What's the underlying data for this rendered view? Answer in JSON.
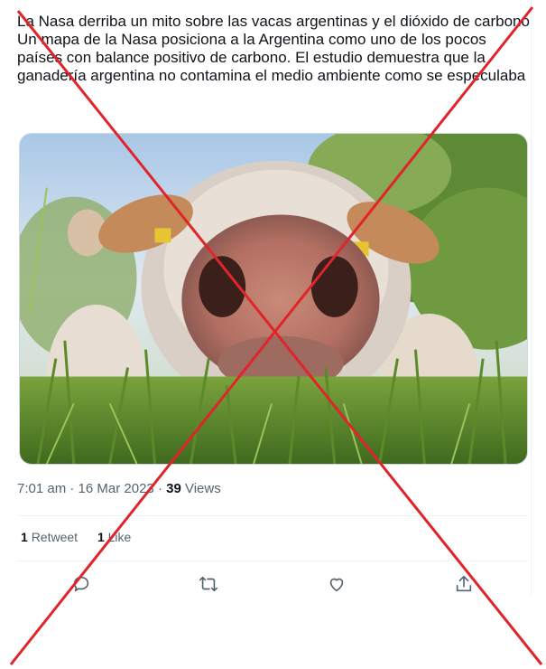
{
  "tweet": {
    "text_lines": [
      "La Nasa derriba un mito sobre las vacas argentinas y el dióxido de carbono",
      "Un mapa de la Nasa posiciona a la Argentina como uno de los pocos países con balance positivo de carbono. El estudio demuestra que la ganadería argentina no contamina el medio ambiente como se especulaba"
    ],
    "time": "7:01 am",
    "separator": "·",
    "date": "16 Mar 2023",
    "views_count": "39",
    "views_label": "Views",
    "retweets_count": "1",
    "retweets_label": "Retweet",
    "likes_count": "1",
    "likes_label": "Like"
  },
  "image": {
    "subject": "close-up cow nose in grass field"
  },
  "actions": [
    "reply-icon",
    "retweet-icon",
    "like-icon",
    "share-icon"
  ],
  "colors": {
    "text": "#0f1419",
    "muted": "#536471",
    "divider": "#eff3f4",
    "cross": "#e0242b"
  }
}
